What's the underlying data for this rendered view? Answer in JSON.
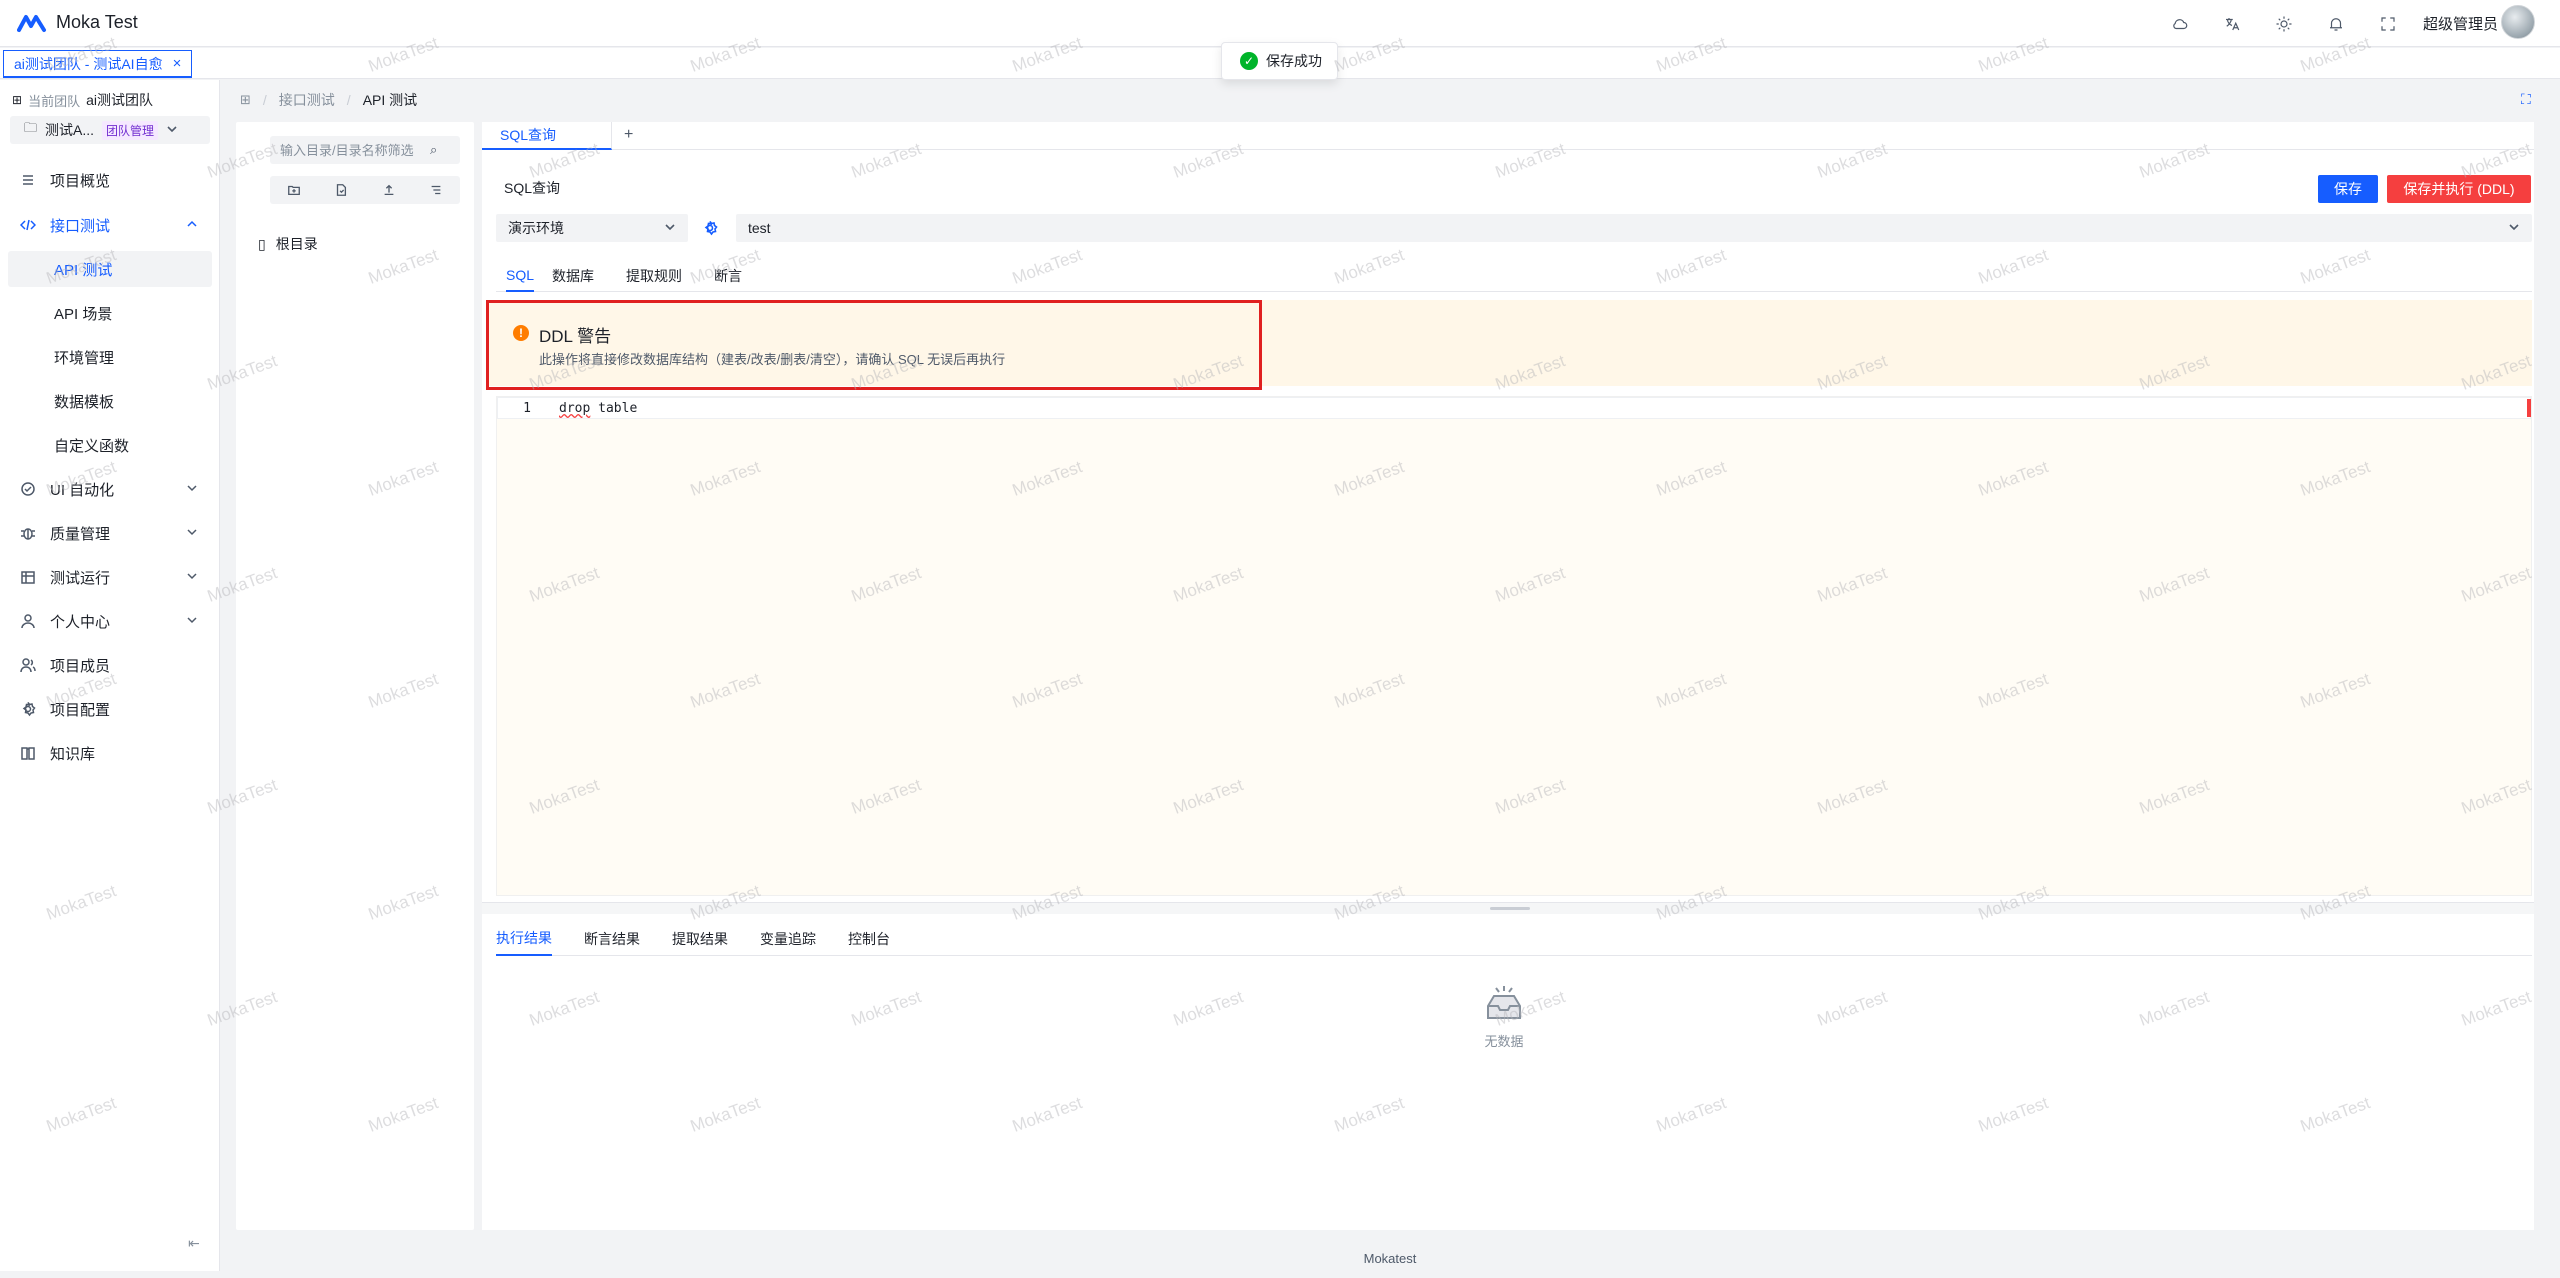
{
  "app": {
    "title": "Moka Test",
    "username": "超级管理员"
  },
  "page_tab": {
    "label": "ai测试团队 - 测试AI自愈",
    "close": "×"
  },
  "toast": {
    "text": "保存成功"
  },
  "sidebar": {
    "team_label": "当前团队",
    "team_name": "ai测试团队",
    "project_name": "测试A...",
    "project_tag": "团队管理",
    "items": [
      {
        "label": "项目概览"
      },
      {
        "label": "接口测试"
      },
      {
        "label": "API 测试"
      },
      {
        "label": "API 场景"
      },
      {
        "label": "环境管理"
      },
      {
        "label": "数据模板"
      },
      {
        "label": "自定义函数"
      },
      {
        "label": "UI 自动化"
      },
      {
        "label": "质量管理"
      },
      {
        "label": "测试运行"
      },
      {
        "label": "个人中心"
      },
      {
        "label": "项目成员"
      },
      {
        "label": "项目配置"
      },
      {
        "label": "知识库"
      }
    ]
  },
  "breadcrumb": {
    "items": [
      "接口测试",
      "API 测试"
    ],
    "sep": "/"
  },
  "tree": {
    "search_placeholder": "输入目录/目录名称筛选",
    "root_label": "根目录"
  },
  "editor_tabs": {
    "active": "SQL查询",
    "add": "+"
  },
  "sql": {
    "title": "SQL查询",
    "save_label": "保存",
    "exec_label": "保存并执行 (DDL)",
    "environment": "演示环境",
    "database": "test",
    "tabs": [
      "SQL",
      "数据库",
      "提取规则",
      "断言"
    ],
    "warning_title": "DDL 警告",
    "warning_text": "此操作将直接修改数据库结构（建表/改表/删表/清空），请确认 SQL 无误后再执行",
    "line_no": "1",
    "code_keyword": "drop",
    "code_rest": " table"
  },
  "results": {
    "tabs": [
      "执行结果",
      "断言结果",
      "提取结果",
      "变量追踪",
      "控制台"
    ],
    "empty_text": "无数据"
  },
  "footer": {
    "text": "Mokatest"
  },
  "watermark": {
    "text": "MokaTest"
  },
  "colors": {
    "primary": "#165dff",
    "danger": "#f53f3f",
    "warning_bg": "#fff7e8",
    "success": "#00b42a"
  }
}
